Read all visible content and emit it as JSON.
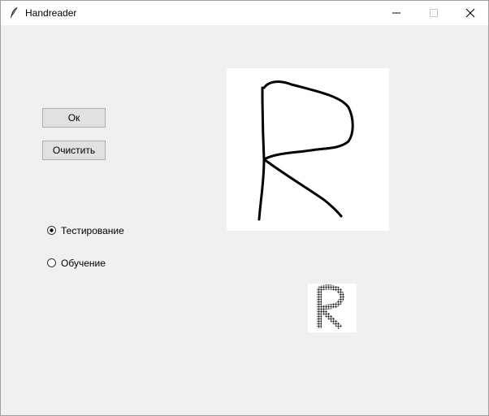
{
  "window": {
    "title": "Handreader",
    "icon": "feather-icon"
  },
  "buttons": {
    "ok_label": "Ок",
    "clear_label": "Очистить"
  },
  "mode": {
    "options": [
      "Тестирование",
      "Обучение"
    ],
    "selected": "Тестирование"
  },
  "drawing": {
    "drawn_character": "R",
    "preview_character": "R"
  },
  "colors": {
    "background": "#f0f0f0",
    "titlebar": "#ffffff",
    "canvas": "#ffffff",
    "stroke": "#000000"
  }
}
